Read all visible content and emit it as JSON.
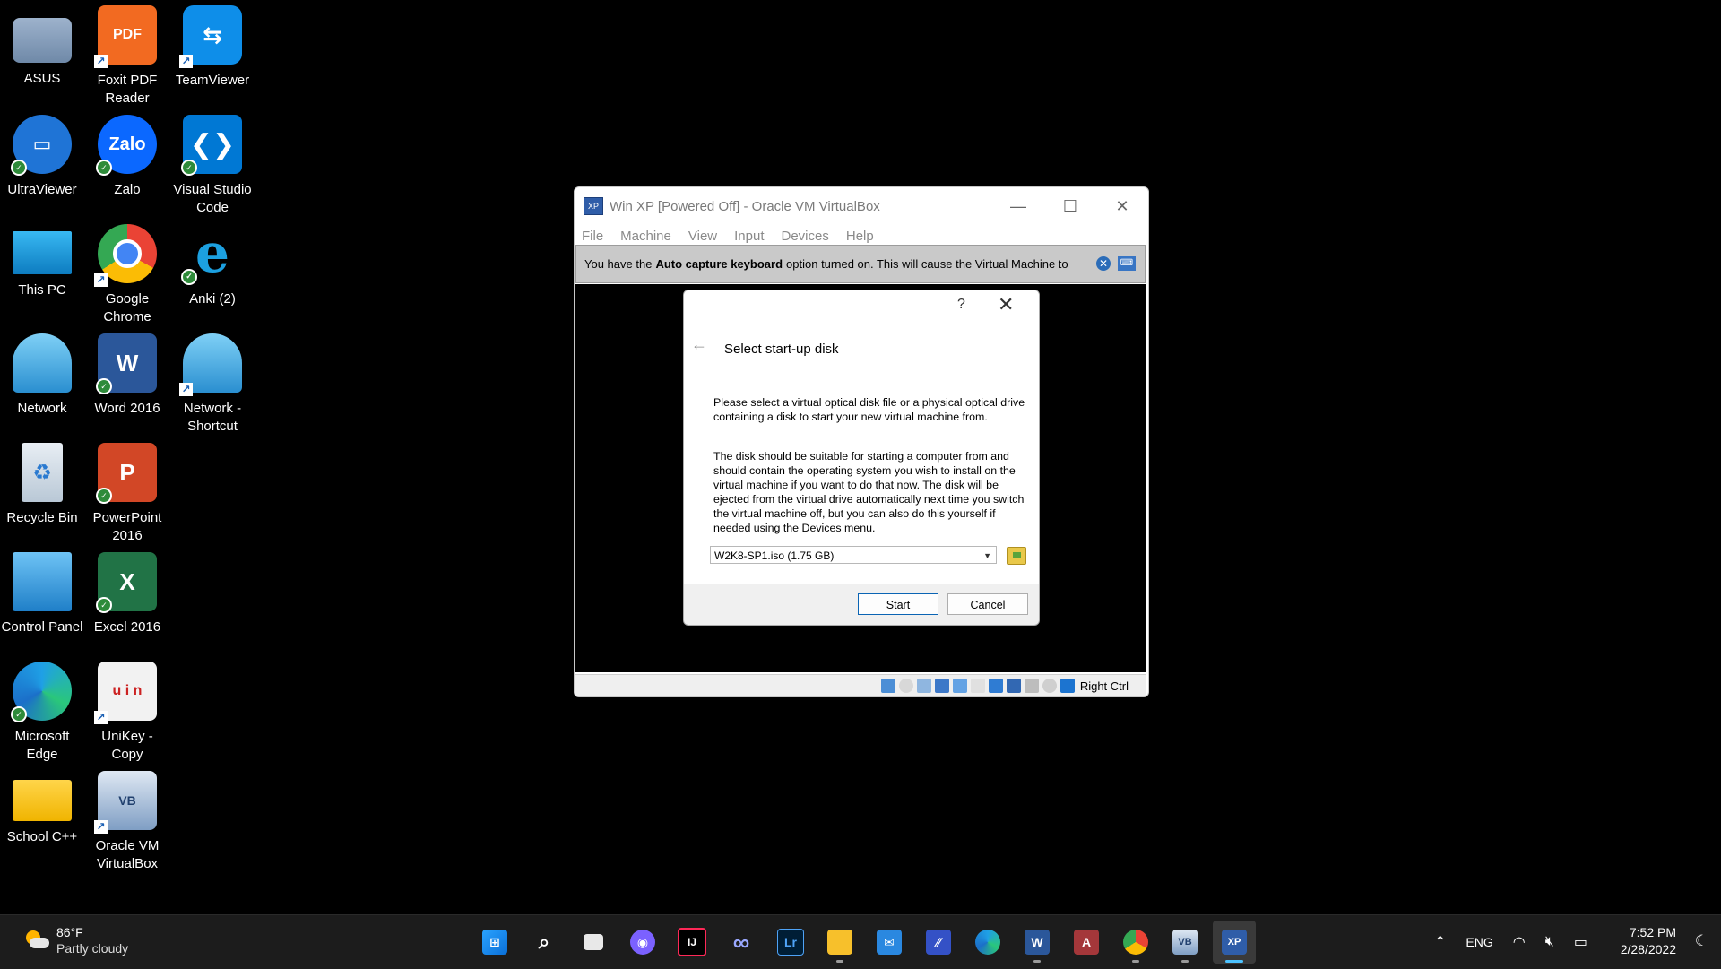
{
  "desktop": {
    "icons": [
      {
        "label": "ASUS"
      },
      {
        "label": "Foxit PDF\nReader"
      },
      {
        "label": "TeamViewer"
      },
      {
        "label": "UltraViewer"
      },
      {
        "label": "Zalo"
      },
      {
        "label": "Visual Studio\nCode"
      },
      {
        "label": "This PC"
      },
      {
        "label": "Google\nChrome"
      },
      {
        "label": "Anki (2)"
      },
      {
        "label": "Network"
      },
      {
        "label": "Word 2016"
      },
      {
        "label": "Network -\nShortcut"
      },
      {
        "label": "Recycle Bin"
      },
      {
        "label": "PowerPoint\n2016"
      },
      {
        "label": "Control Panel"
      },
      {
        "label": "Excel 2016"
      },
      {
        "label": "Microsoft\nEdge"
      },
      {
        "label": "UniKey -\nCopy"
      },
      {
        "label": "School C++"
      },
      {
        "label": "Oracle VM\nVirtualBox"
      }
    ]
  },
  "vbox": {
    "title": "Win XP [Powered Off] - Oracle VM VirtualBox",
    "menu": [
      "File",
      "Machine",
      "View",
      "Input",
      "Devices",
      "Help"
    ],
    "notice_pre": "You have the",
    "notice_bold": "Auto capture keyboard",
    "notice_post": "option turned on. This will cause the Virtual Machine to",
    "host_key": "Right Ctrl"
  },
  "dialog": {
    "help": "?",
    "heading": "Select start-up disk",
    "para1": "Please select a virtual optical disk file or a physical optical drive containing a disk to start your new virtual machine from.",
    "para2": "The disk should be suitable for starting a computer from and should contain the operating system you wish to install on the virtual machine if you want to do that now. The disk will be ejected from the virtual drive automatically next time you switch the virtual machine off, but you can also do this yourself if needed using the Devices menu.",
    "selected_disk": "W2K8-SP1.iso (1.75 GB)",
    "start_label": "Start",
    "cancel_label": "Cancel"
  },
  "taskbar": {
    "temperature": "86°F",
    "weather": "Partly cloudy",
    "language": "ENG",
    "time": "7:52 PM",
    "date": "2/28/2022"
  }
}
